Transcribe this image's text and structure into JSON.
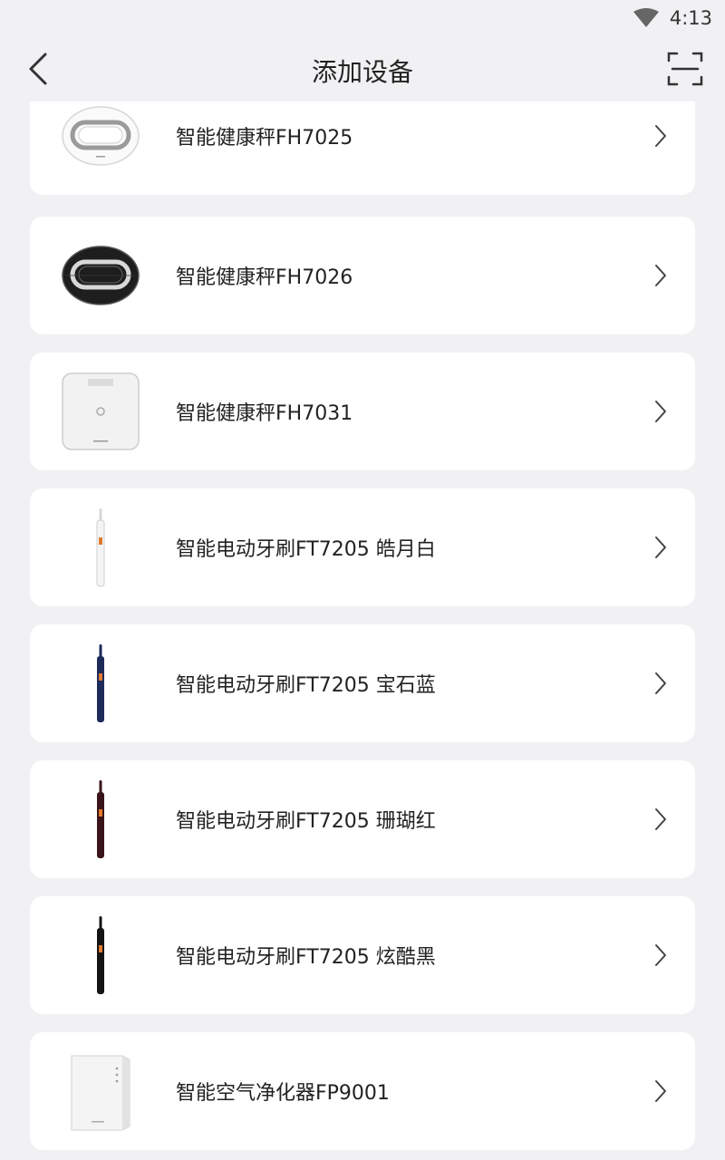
{
  "status_bar": {
    "time": "4:13"
  },
  "header": {
    "title": "添加设备"
  },
  "devices": [
    {
      "name": "智能健康秤FH7025",
      "image": "white-oval-scale"
    },
    {
      "name": "智能健康秤FH7026",
      "image": "black-oval-scale"
    },
    {
      "name": "智能健康秤FH7031",
      "image": "white-square-scale"
    },
    {
      "name": "智能电动牙刷FT7205 皓月白",
      "image": "white-toothbrush"
    },
    {
      "name": "智能电动牙刷FT7205 宝石蓝",
      "image": "blue-toothbrush"
    },
    {
      "name": "智能电动牙刷FT7205 珊瑚红",
      "image": "red-toothbrush"
    },
    {
      "name": "智能电动牙刷FT7205 炫酷黑",
      "image": "black-toothbrush"
    },
    {
      "name": "智能空气净化器FP9001",
      "image": "air-purifier"
    }
  ],
  "colors": {
    "background": "#f1f1f4",
    "card": "#ffffff",
    "brush_white": "#f4f4f4",
    "brush_blue": "#1d2a5a",
    "brush_red": "#3a1418",
    "brush_black": "#141414"
  }
}
